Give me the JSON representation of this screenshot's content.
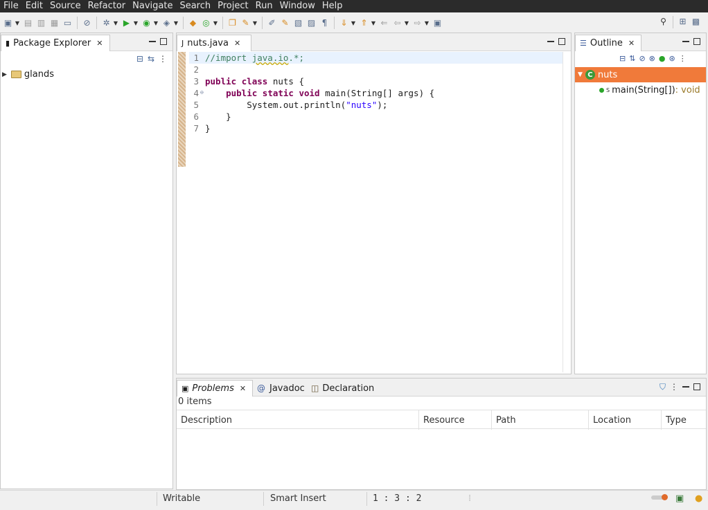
{
  "menu": [
    "File",
    "Edit",
    "Source",
    "Refactor",
    "Navigate",
    "Search",
    "Project",
    "Run",
    "Window",
    "Help"
  ],
  "package_explorer": {
    "title": "Package Explorer",
    "items": [
      {
        "label": "glands"
      }
    ]
  },
  "editor": {
    "tab_title": "nuts.java",
    "lines": [
      {
        "num": "1"
      },
      {
        "num": "2"
      },
      {
        "num": "3"
      },
      {
        "num": "4"
      },
      {
        "num": "5"
      },
      {
        "num": "6"
      },
      {
        "num": "7"
      }
    ],
    "code": {
      "l1_a": "//import ",
      "l1_b": "java.io",
      "l1_c": ".*;",
      "l3_kw1": "public",
      "l3_kw2": "class",
      "l3_rest": " nuts {",
      "l4_indent": "    ",
      "l4_kw1": "public",
      "l4_kw2": "static",
      "l4_kw3": "void",
      "l4_rest": " main(String[] args) {",
      "l5_a": "        System.out.println(",
      "l5_str": "\"nuts\"",
      "l5_b": ");",
      "l6": "    }",
      "l7": "}"
    }
  },
  "outline": {
    "title": "Outline",
    "class_name": "nuts",
    "class_icon": "C",
    "method_modifier": "S",
    "method_sig": "main(String[])",
    "method_return": " : void"
  },
  "problems": {
    "tabs": [
      "Problems",
      "Javadoc",
      "Declaration"
    ],
    "count": "0 items",
    "columns": [
      "Description",
      "Resource",
      "Path",
      "Location",
      "Type"
    ]
  },
  "status": {
    "mode": "Writable",
    "insert": "Smart Insert",
    "position": "1 : 3 : 2"
  }
}
